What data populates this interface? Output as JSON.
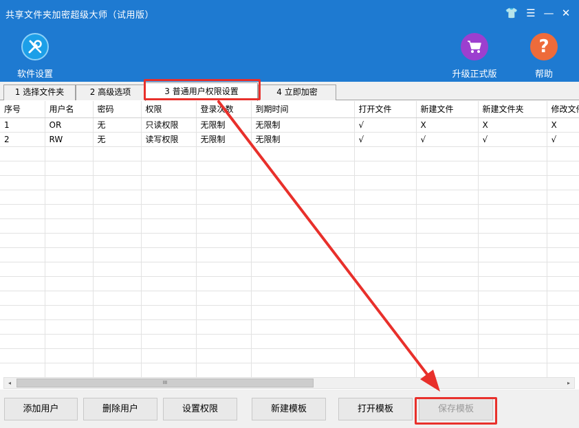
{
  "window": {
    "title": "共享文件夹加密超级大师（试用版）",
    "controls": {
      "skin": "👕",
      "menu": "☰",
      "minimize": "—",
      "close": "✕"
    }
  },
  "header_buttons": [
    {
      "label": "软件设置",
      "icon": "wrench-screwdriver-icon"
    },
    {
      "label": "升级正式版",
      "icon": "shopping-cart-icon"
    },
    {
      "label": "帮助",
      "icon": "question-mark-icon",
      "glyph": "?"
    }
  ],
  "tabs": [
    {
      "label": "1 选择文件夹"
    },
    {
      "label": "2 高级选项"
    },
    {
      "label": "3 普通用户权限设置",
      "active": true
    },
    {
      "label": "4 立即加密"
    }
  ],
  "table": {
    "columns": [
      "序号",
      "用户名",
      "密码",
      "权限",
      "登录次数",
      "到期时间",
      "打开文件",
      "新建文件",
      "新建文件夹",
      "修改文件"
    ],
    "rows": [
      [
        "1",
        "OR",
        "无",
        "只读权限",
        "无限制",
        "无限制",
        "√",
        "X",
        "X",
        "X"
      ],
      [
        "2",
        "RW",
        "无",
        "读写权限",
        "无限制",
        "无限制",
        "√",
        "√",
        "√",
        "√"
      ]
    ],
    "empty_rows": 17
  },
  "scrollbar": {
    "left": "◂",
    "right": "▸",
    "grip": "III"
  },
  "buttons": {
    "add_user": "添加用户",
    "delete_user": "删除用户",
    "set_permission": "设置权限",
    "new_template": "新建模板",
    "open_template": "打开模板",
    "save_template": "保存模板"
  },
  "colors": {
    "header_bg": "#1e7ad1",
    "highlight": "#e8302b",
    "settings_icon": "#1c9fe8",
    "upgrade_icon": "#9c3fcf",
    "help_icon": "#ee6b3b"
  }
}
